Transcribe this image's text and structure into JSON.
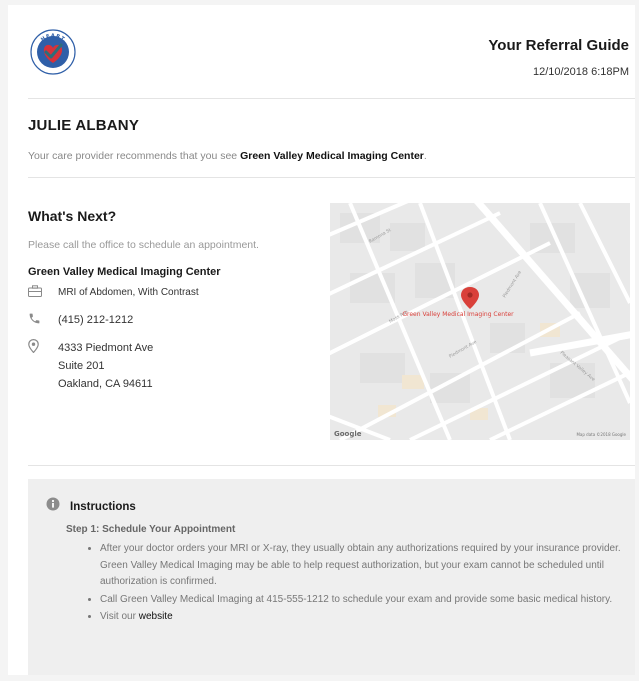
{
  "header": {
    "logo_text_top": "HEART",
    "logo_text_bottom": "HEALTHY",
    "title": "Your Referral Guide",
    "timestamp": "12/10/2018 6:18PM"
  },
  "patient": {
    "name": "JULIE ALBANY",
    "recommend_prefix": "Your care provider recommends that you see ",
    "recommend_facility": "Green Valley Medical Imaging Center",
    "recommend_suffix": "."
  },
  "next": {
    "title": "What's Next?",
    "instruction": "Please call the office to schedule an appointment.",
    "facility_name": "Green Valley Medical Imaging Center",
    "procedure": "MRI of Abdomen, With Contrast",
    "phone": "(415) 212-1212",
    "address_line1": "4333 Piedmont Ave",
    "address_line2": "Suite 201",
    "address_line3": "Oakland, CA 94611",
    "icons": [
      "briefcase-icon",
      "phone-icon",
      "location-pin-icon"
    ]
  },
  "map": {
    "marker_label": "Green Valley Medical Imaging Center",
    "attribution_logo": "Google",
    "attribution_text": "Map data ©2018 Google",
    "pin_color": "#d9403a"
  },
  "instructions": {
    "title": "Instructions",
    "step_title": "Step 1: Schedule Your Appointment",
    "bullets": [
      "After your doctor orders your MRI or X-ray, they usually obtain any authorizations required by your insurance provider. Green Valley Medical Imaging may be able to help request authorization, but your exam cannot be scheduled until authorization is confirmed.",
      "Call Green Valley Medical Imaging at 415-555-1212 to schedule your exam and provide some basic medical history."
    ],
    "visit_prefix": "Visit our ",
    "visit_link": "website"
  },
  "colors": {
    "logo_blue": "#2f5fa8",
    "logo_red": "#d6323a",
    "check_teal": "#2c6e7a",
    "instructions_bg": "#efefef"
  }
}
